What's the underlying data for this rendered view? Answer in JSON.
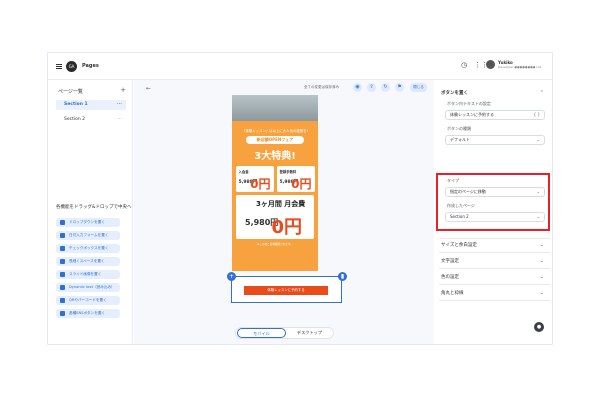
{
  "header": {
    "app_title": "Pages",
    "logo_text": "GA",
    "user_name": "Yukiko",
    "user_sub": "Developer ●●●●●●●● Ltd."
  },
  "sidebar": {
    "pages_title": "ページ一覧",
    "pages": [
      {
        "label": "Section 1"
      },
      {
        "label": "Section 2"
      }
    ],
    "drag_title": "各機能をドラッグ&ドロップで中央へ",
    "tools": [
      {
        "label": "ドロップダウンを置く"
      },
      {
        "label": "日付入力フォームを置く"
      },
      {
        "label": "チェックボックスを置く"
      },
      {
        "label": "長細くスペースを置く"
      },
      {
        "label": "スライド画像を置く"
      },
      {
        "label": "Dynamic text（読み込み）"
      },
      {
        "label": "QRやバーコードを置く"
      },
      {
        "label": "各種SNSボタンを置く"
      }
    ]
  },
  "canvas": {
    "saved_text": "全ての変更は保存済み",
    "close_label": "閉じる",
    "poster": {
      "top_text": "「体験レッスン」は以上に大人気の施策を!",
      "pill_text": "新店舗OPENフェア",
      "headline": "3大特典!",
      "card1_label": "入会金",
      "card1_old": "5,980円",
      "card1_zero": "0円",
      "card2_label": "登録手数料",
      "card2_old": "5,980円",
      "card2_zero": "0円",
      "card3_title": "3ヶ月間 月会費",
      "card3_old": "5,980円",
      "card3_zero": "0円",
      "fine_print": "※このあと自動継続されます。"
    },
    "cta_label": "体験レッスンに予約する",
    "view_mobile": "モバイル",
    "view_desktop": "デスクトップ"
  },
  "panel": {
    "button_section_title": "ボタンを置く",
    "button_text_label": "ボタン内テキストの設定",
    "button_text_value": "体験レッスンに予約する",
    "button_kind_label": "ボタンの種類",
    "button_kind_value": "デフォルト",
    "type_label": "タイプ",
    "type_value": "指定のページに移動",
    "target_label": "作成したページ",
    "target_value": "Section 2",
    "sections": [
      {
        "label": "サイズと余白設定"
      },
      {
        "label": "文字設定"
      },
      {
        "label": "色の設定"
      },
      {
        "label": "角丸と枠線"
      }
    ]
  }
}
